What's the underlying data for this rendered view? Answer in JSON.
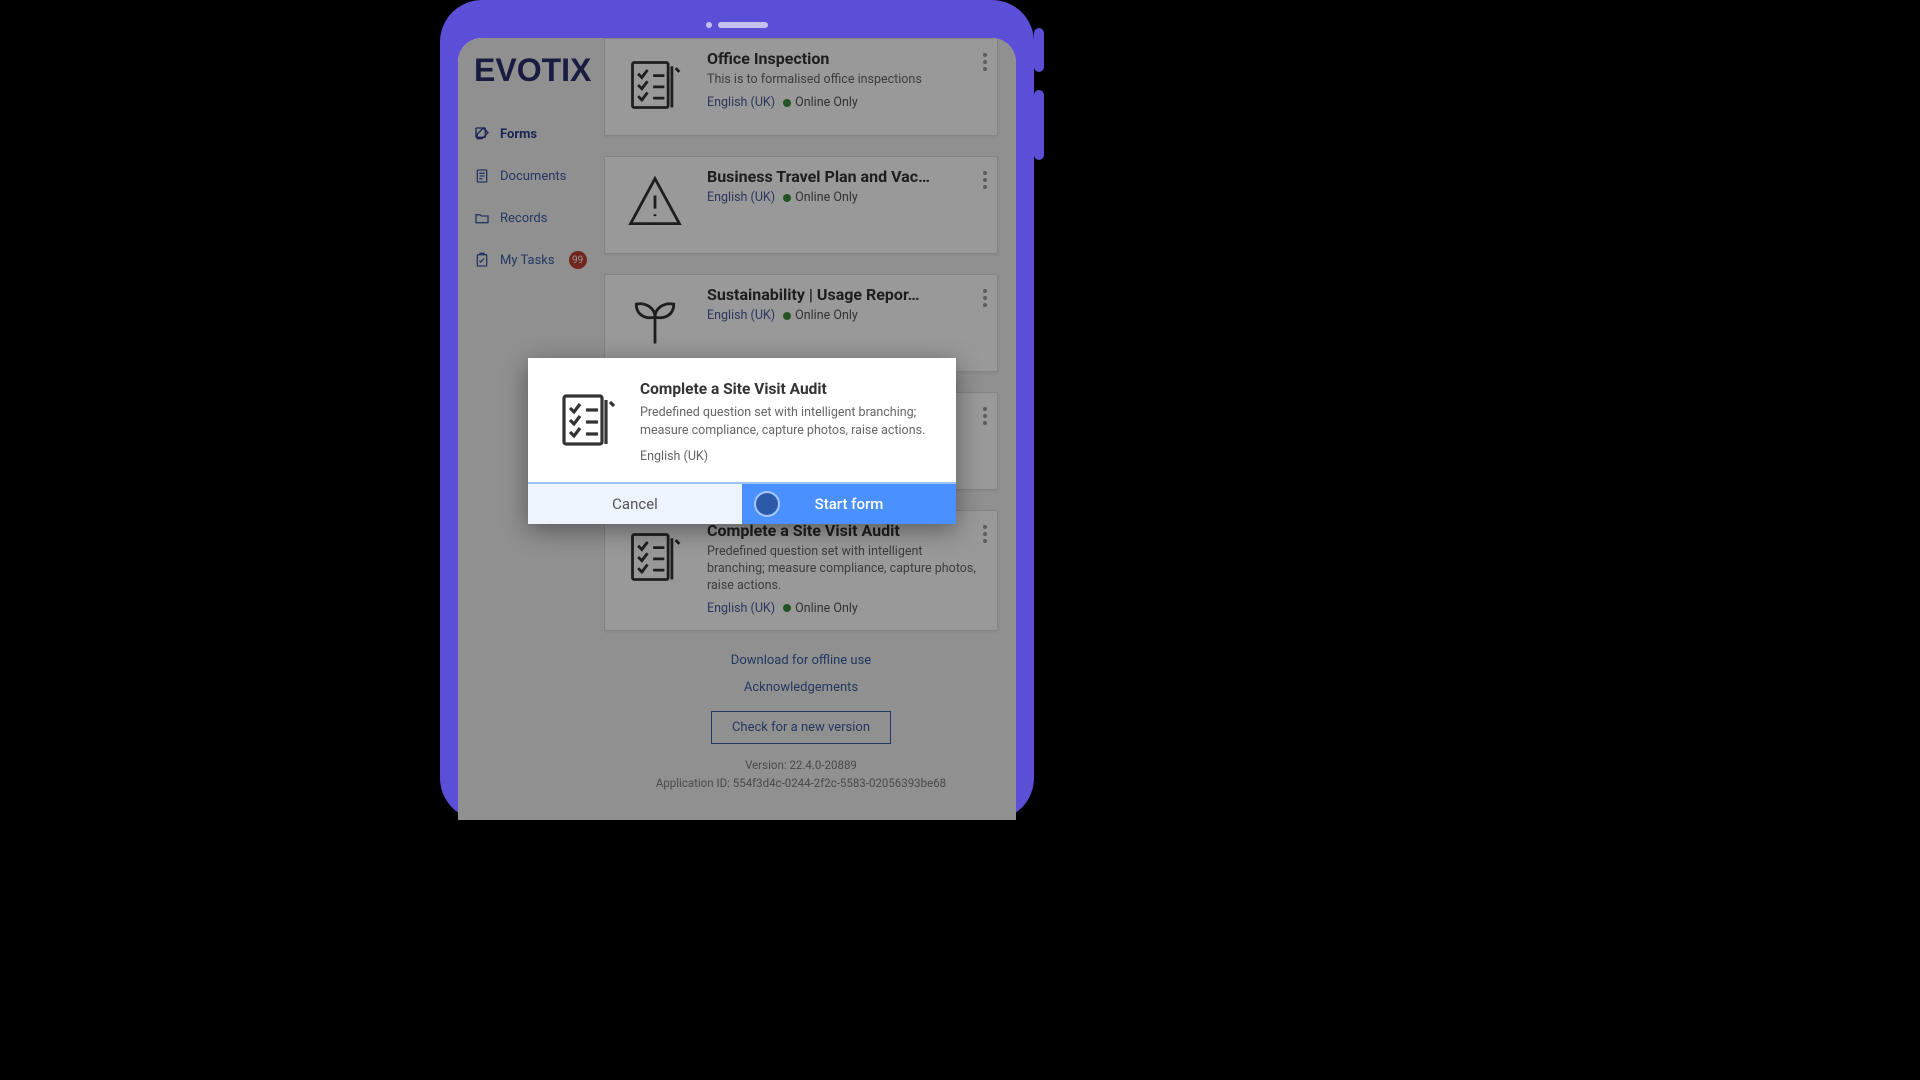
{
  "brand": "EVOTIX",
  "sidebar": {
    "items": [
      {
        "label": "Forms",
        "active": true
      },
      {
        "label": "Documents"
      },
      {
        "label": "Records"
      },
      {
        "label": "My Tasks",
        "badge": "99"
      }
    ]
  },
  "forms": [
    {
      "title": "Office Inspection",
      "desc": "This is to formalised office inspections",
      "lang": "English (UK)",
      "online": "Online Only",
      "icon": "checklist"
    },
    {
      "title": "Business Travel Plan and Vac…",
      "desc": "",
      "lang": "English (UK)",
      "online": "Online Only",
      "icon": "warning"
    },
    {
      "title": "Sustainability | Usage Repor…",
      "desc": "",
      "lang": "English (UK)",
      "online": "Online Only",
      "icon": "plant"
    },
    {
      "title": "",
      "desc": "",
      "lang": "",
      "online": "",
      "icon": "spacer"
    },
    {
      "title": "Complete a Site Visit Audit",
      "desc": "Predefined question set with intelligent branching; measure compliance, capture photos, raise actions.",
      "lang": "English (UK)",
      "online": "Online Only",
      "icon": "checklist"
    }
  ],
  "footer": {
    "download": "Download for offline use",
    "ack": "Acknowledgements",
    "check": "Check for a new version",
    "version": "Version: 22.4.0-20889",
    "appid": "Application ID: 554f3d4c-0244-2f2c-5583-02056393be68"
  },
  "modal": {
    "title": "Complete a Site Visit Audit",
    "desc": "Predefined question set with intelligent branching; measure compliance, capture photos, raise actions.",
    "lang": "English (UK)",
    "cancel": "Cancel",
    "start": "Start form"
  }
}
